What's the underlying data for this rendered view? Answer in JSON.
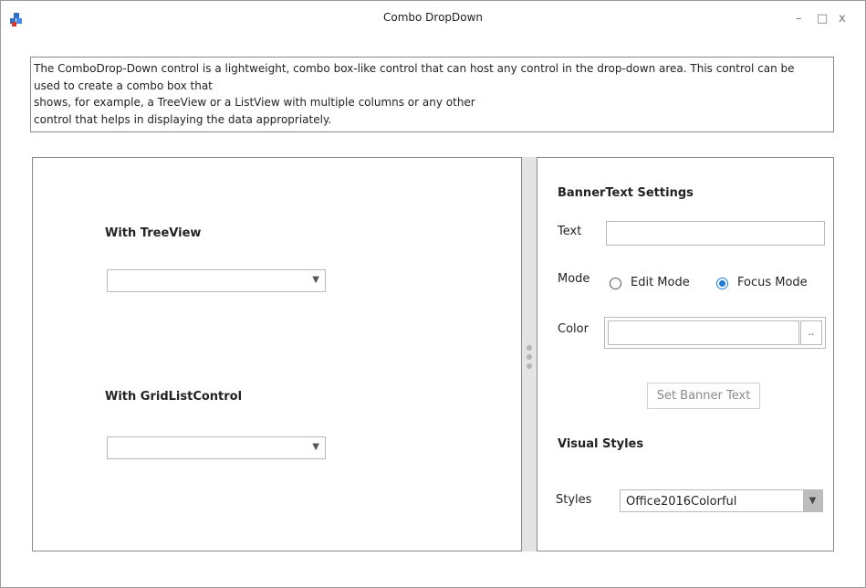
{
  "window": {
    "title": "Combo DropDown",
    "minimize_label": "–",
    "maximize_label": "□",
    "close_label": "x"
  },
  "description": {
    "lines": [
      "The ComboDrop-Down control is a lightweight, combo box-like control that can host any control in the drop-down area. This control can be",
      "used to create a combo box that",
      "shows, for example, a TreeView or a ListView with multiple columns or any other",
      "control that helps in displaying the data appropriately."
    ]
  },
  "left_panel": {
    "treeview_label": "With TreeView",
    "treeview_value": "",
    "gridlist_label": "With GridListControl",
    "gridlist_value": "",
    "dropdown_arrow": "▼"
  },
  "banner_settings": {
    "heading": "BannerText Settings",
    "text_label": "Text",
    "text_value": "",
    "mode_label": "Mode",
    "mode_options": [
      "Edit Mode",
      "Focus Mode"
    ],
    "mode_selected": "Focus Mode",
    "color_label": "Color",
    "color_value": "",
    "color_button": "..",
    "set_button": "Set Banner Text"
  },
  "visual_styles": {
    "heading": "Visual Styles",
    "styles_label": "Styles",
    "styles_value": "Office2016Colorful",
    "dropdown_arrow": "▼"
  },
  "colors": {
    "radio_accent": "#1e7bd6",
    "splitter": "#e4e4e4",
    "border": "#8a8a8a"
  }
}
